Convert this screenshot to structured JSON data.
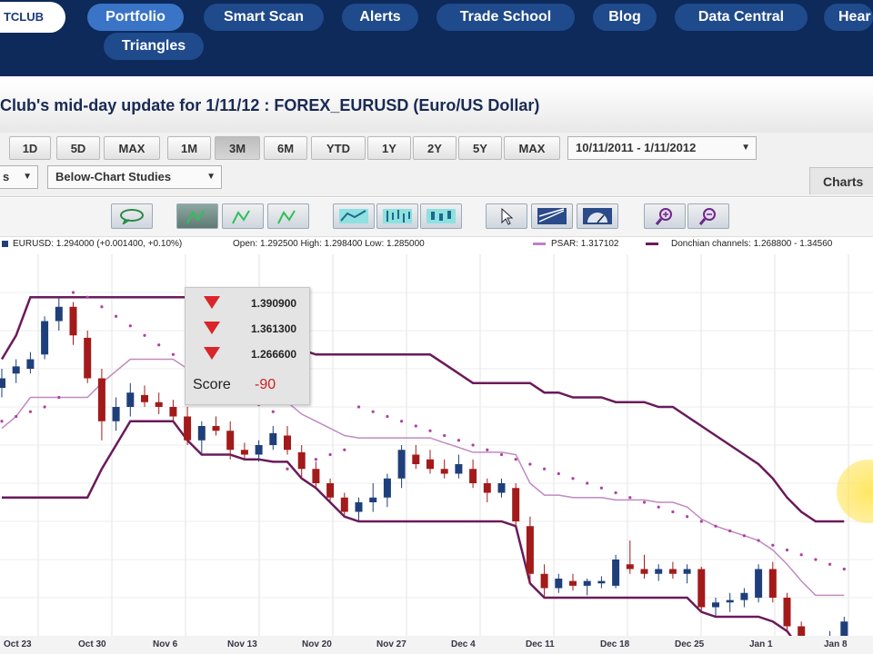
{
  "nav": {
    "logo_text": "TCLUB",
    "items": [
      "Portfolio",
      "Smart Scan",
      "Alerts",
      "Trade School",
      "Blog",
      "Data Central",
      "Hear",
      "Triangles"
    ]
  },
  "page": {
    "title": "Club's mid-day update for 1/11/12 : FOREX_EURUSD (Euro/US Dollar)"
  },
  "toolbar": {
    "range_buttons": [
      "1D",
      "5D",
      "MAX",
      "1M",
      "3M",
      "6M",
      "YTD",
      "1Y",
      "2Y",
      "5Y",
      "MAX"
    ],
    "selected_range": "3M",
    "date_range": "10/11/2011 - 1/11/2012",
    "studies_dropdown": "s",
    "below_chart_studies": "Below-Chart Studies",
    "charts_tab": "Charts"
  },
  "legend": {
    "symbol_text": "EURUSD: 1.294000 (+0.001400, +0.10%)",
    "ohlc_text": "Open: 1.292500  High: 1.298400  Low: 1.285000",
    "psar_text": "PSAR: 1.317102",
    "donchian_text": "Donchian channels: 1.268800 - 1.34560",
    "psar_color": "#c080c8",
    "donchian_color": "#6a1a5a"
  },
  "popup": {
    "values": [
      "1.390900",
      "1.361300",
      "1.266600"
    ],
    "score_label": "Score",
    "score_value": "-90"
  },
  "chart_data": {
    "type": "candlestick",
    "x_labels": [
      "Oct 23",
      "Oct 30",
      "Nov 6",
      "Nov 13",
      "Nov 20",
      "Nov 27",
      "Dec 4",
      "Dec 11",
      "Dec 18",
      "Dec 25",
      "Jan 1",
      "Jan 8"
    ],
    "y_range": [
      1.26,
      1.42
    ],
    "colors": {
      "up": "#1f3f7a",
      "down": "#a31a1a"
    },
    "candles": [
      [
        1.364,
        1.372,
        1.36,
        1.368
      ],
      [
        1.37,
        1.376,
        1.366,
        1.373
      ],
      [
        1.372,
        1.379,
        1.37,
        1.376
      ],
      [
        1.378,
        1.394,
        1.376,
        1.392
      ],
      [
        1.392,
        1.402,
        1.388,
        1.398
      ],
      [
        1.398,
        1.4,
        1.382,
        1.386
      ],
      [
        1.385,
        1.388,
        1.366,
        1.368
      ],
      [
        1.368,
        1.372,
        1.342,
        1.35
      ],
      [
        1.35,
        1.36,
        1.346,
        1.356
      ],
      [
        1.356,
        1.366,
        1.352,
        1.362
      ],
      [
        1.361,
        1.365,
        1.356,
        1.358
      ],
      [
        1.358,
        1.362,
        1.353,
        1.356
      ],
      [
        1.356,
        1.359,
        1.35,
        1.352
      ],
      [
        1.352,
        1.356,
        1.34,
        1.342
      ],
      [
        1.342,
        1.35,
        1.336,
        1.348
      ],
      [
        1.348,
        1.352,
        1.344,
        1.346
      ],
      [
        1.346,
        1.35,
        1.334,
        1.338
      ],
      [
        1.338,
        1.341,
        1.334,
        1.336
      ],
      [
        1.336,
        1.342,
        1.333,
        1.34
      ],
      [
        1.34,
        1.348,
        1.338,
        1.345
      ],
      [
        1.344,
        1.348,
        1.336,
        1.338
      ],
      [
        1.337,
        1.34,
        1.326,
        1.33
      ],
      [
        1.33,
        1.333,
        1.322,
        1.324
      ],
      [
        1.324,
        1.326,
        1.316,
        1.318
      ],
      [
        1.318,
        1.32,
        1.31,
        1.312
      ],
      [
        1.312,
        1.318,
        1.308,
        1.316
      ],
      [
        1.316,
        1.324,
        1.312,
        1.318
      ],
      [
        1.318,
        1.328,
        1.314,
        1.326
      ],
      [
        1.326,
        1.34,
        1.322,
        1.338
      ],
      [
        1.336,
        1.34,
        1.33,
        1.332
      ],
      [
        1.334,
        1.338,
        1.328,
        1.33
      ],
      [
        1.33,
        1.334,
        1.326,
        1.328
      ],
      [
        1.328,
        1.336,
        1.326,
        1.332
      ],
      [
        1.33,
        1.334,
        1.322,
        1.324
      ],
      [
        1.324,
        1.326,
        1.316,
        1.32
      ],
      [
        1.32,
        1.326,
        1.318,
        1.324
      ],
      [
        1.322,
        1.324,
        1.306,
        1.308
      ],
      [
        1.306,
        1.31,
        1.282,
        1.286
      ],
      [
        1.286,
        1.29,
        1.276,
        1.28
      ],
      [
        1.28,
        1.286,
        1.278,
        1.284
      ],
      [
        1.283,
        1.286,
        1.279,
        1.281
      ],
      [
        1.281,
        1.284,
        1.277,
        1.283
      ],
      [
        1.282,
        1.285,
        1.28,
        1.283
      ],
      [
        1.281,
        1.294,
        1.28,
        1.292
      ],
      [
        1.29,
        1.3,
        1.286,
        1.288
      ],
      [
        1.288,
        1.294,
        1.284,
        1.286
      ],
      [
        1.286,
        1.29,
        1.283,
        1.288
      ],
      [
        1.288,
        1.291,
        1.284,
        1.286
      ],
      [
        1.286,
        1.29,
        1.282,
        1.288
      ],
      [
        1.288,
        1.289,
        1.27,
        1.272
      ],
      [
        1.272,
        1.276,
        1.268,
        1.274
      ],
      [
        1.274,
        1.278,
        1.27,
        1.275
      ],
      [
        1.275,
        1.28,
        1.272,
        1.278
      ],
      [
        1.276,
        1.29,
        1.274,
        1.288
      ],
      [
        1.288,
        1.291,
        1.274,
        1.276
      ],
      [
        1.276,
        1.278,
        1.262,
        1.264
      ],
      [
        1.264,
        1.266,
        1.254,
        1.256
      ],
      [
        1.254,
        1.258,
        1.246,
        1.25
      ],
      [
        1.25,
        1.262,
        1.249,
        1.26
      ],
      [
        1.26,
        1.268,
        1.257,
        1.266
      ]
    ],
    "psar": [
      1.35,
      1.352,
      1.354,
      1.356,
      1.36,
      1.404,
      1.402,
      1.398,
      1.394,
      1.39,
      1.386,
      1.382,
      1.378,
      1.374,
      1.37,
      1.366,
      1.363,
      1.36,
      1.357,
      1.354,
      1.33,
      1.332,
      1.334,
      1.336,
      1.338,
      1.356,
      1.354,
      1.352,
      1.35,
      1.348,
      1.346,
      1.344,
      1.342,
      1.34,
      1.338,
      1.336,
      1.334,
      1.332,
      1.33,
      1.328,
      1.326,
      1.324,
      1.322,
      1.32,
      1.318,
      1.316,
      1.314,
      1.312,
      1.31,
      1.308,
      1.306,
      1.304,
      1.302,
      1.3,
      1.298,
      1.296,
      1.294,
      1.292,
      1.29,
      1.288
    ],
    "donchian_upper": [
      1.376,
      1.386,
      1.402,
      1.402,
      1.402,
      1.402,
      1.402,
      1.402,
      1.402,
      1.402,
      1.402,
      1.402,
      1.402,
      1.402,
      1.402,
      1.402,
      1.402,
      1.402,
      1.402,
      1.396,
      1.384,
      1.38,
      1.378,
      1.378,
      1.378,
      1.378,
      1.378,
      1.378,
      1.378,
      1.378,
      1.378,
      1.374,
      1.37,
      1.366,
      1.366,
      1.366,
      1.366,
      1.366,
      1.362,
      1.362,
      1.36,
      1.36,
      1.36,
      1.358,
      1.358,
      1.358,
      1.356,
      1.356,
      1.352,
      1.348,
      1.344,
      1.34,
      1.336,
      1.332,
      1.326,
      1.318,
      1.312,
      1.308,
      1.308,
      1.308
    ],
    "donchian_lower": [
      1.318,
      1.318,
      1.318,
      1.318,
      1.318,
      1.318,
      1.318,
      1.33,
      1.34,
      1.35,
      1.35,
      1.35,
      1.35,
      1.342,
      1.336,
      1.336,
      1.336,
      1.334,
      1.334,
      1.333,
      1.333,
      1.326,
      1.322,
      1.316,
      1.31,
      1.308,
      1.308,
      1.308,
      1.308,
      1.308,
      1.308,
      1.308,
      1.308,
      1.308,
      1.308,
      1.308,
      1.306,
      1.282,
      1.276,
      1.276,
      1.276,
      1.276,
      1.276,
      1.276,
      1.276,
      1.276,
      1.276,
      1.276,
      1.276,
      1.27,
      1.268,
      1.268,
      1.268,
      1.268,
      1.266,
      1.262,
      1.254,
      1.246,
      1.246,
      1.246
    ],
    "channel_mid": [
      1.347,
      1.352,
      1.36,
      1.36,
      1.36,
      1.36,
      1.36,
      1.366,
      1.371,
      1.376,
      1.376,
      1.376,
      1.376,
      1.372,
      1.369,
      1.369,
      1.369,
      1.368,
      1.368,
      1.365,
      1.358,
      1.353,
      1.35,
      1.347,
      1.344,
      1.343,
      1.343,
      1.343,
      1.343,
      1.343,
      1.343,
      1.341,
      1.339,
      1.337,
      1.337,
      1.337,
      1.336,
      1.324,
      1.319,
      1.319,
      1.318,
      1.318,
      1.318,
      1.317,
      1.317,
      1.317,
      1.316,
      1.316,
      1.314,
      1.309,
      1.306,
      1.304,
      1.302,
      1.3,
      1.296,
      1.29,
      1.283,
      1.277,
      1.277,
      1.277
    ]
  }
}
